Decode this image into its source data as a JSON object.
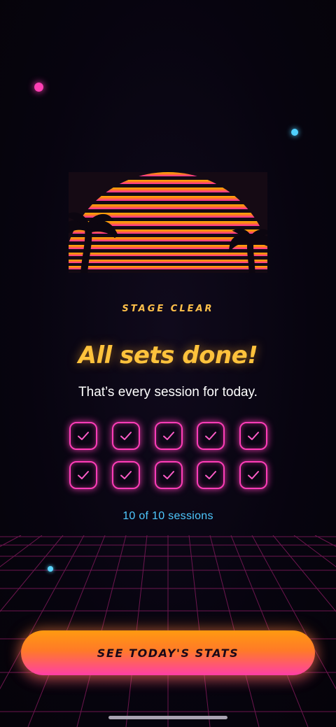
{
  "stage": {
    "eyebrow": "STAGE CLEAR",
    "title": "All sets done!",
    "subtitle": "That’s every session for today."
  },
  "sessions": {
    "completed": 10,
    "total": 10,
    "label": "10 of 10 sessions"
  },
  "cta": {
    "label": "SEE TODAY'S STATS"
  },
  "icons": [
    "sunset-illustration",
    "palm-tree-icon",
    "checkmark-icon"
  ],
  "colors": {
    "background": "#07040f",
    "accent_pink": "#ff3db8",
    "accent_orange": "#ff8a1e",
    "title_yellow": "#ffc23c",
    "count_cyan": "#4ec8ff"
  }
}
